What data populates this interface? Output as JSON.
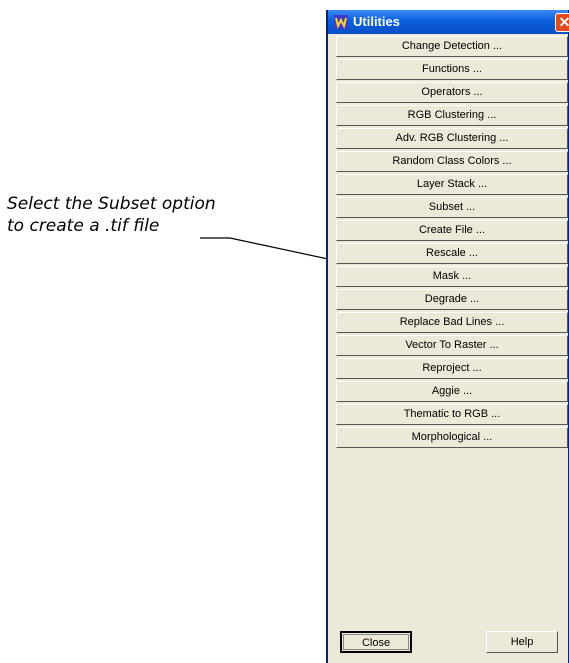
{
  "annotation": {
    "line1": "Select the Subset option",
    "line2": "to create a .tif file"
  },
  "window": {
    "title": "Utilities",
    "icon": "app-icon",
    "close_glyph": "✕"
  },
  "buttons": [
    "Change Detection ...",
    "Functions ...",
    "Operators ...",
    "RGB Clustering ...",
    "Adv. RGB Clustering ...",
    "Random Class Colors ...",
    "Layer Stack ...",
    "Subset ...",
    "Create File ...",
    "Rescale ...",
    "Mask ...",
    "Degrade ...",
    "Replace Bad Lines ...",
    "Vector To Raster ...",
    "Reproject ...",
    "Aggie ...",
    "Thematic to RGB ...",
    "Morphological ..."
  ],
  "footer": {
    "close_label": "Close",
    "help_label": "Help"
  }
}
